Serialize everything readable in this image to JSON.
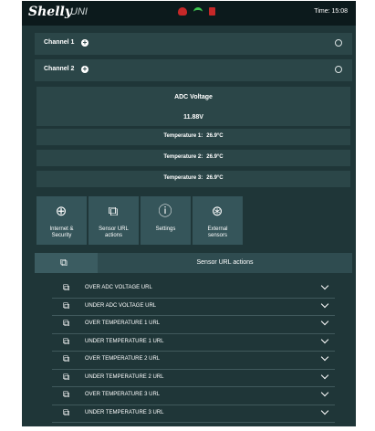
{
  "header": {
    "logo": "Shelly",
    "logo_sub": "UNI",
    "time": "Time: 15:08",
    "status_icons": [
      "cloud-icon",
      "wifi-icon",
      "lock-icon"
    ],
    "colors": {
      "cloud": "#c62828",
      "wifi": "#3ec850",
      "lock": "#c62828"
    }
  },
  "channels": [
    {
      "label": "Channel 1"
    },
    {
      "label": "Channel 2"
    }
  ],
  "adc": {
    "title": "ADC Voltage",
    "value": "11.88V"
  },
  "temperatures": [
    {
      "label": "Temperature 1:",
      "value": "26.9°C"
    },
    {
      "label": "Temperature 2:",
      "value": "26.9°C"
    },
    {
      "label": "Temperature 3:",
      "value": "26.9°C"
    }
  ],
  "tiles": [
    {
      "label": "Internet &\nSecurity",
      "icon": "globe-icon"
    },
    {
      "label": "Sensor URL\nactions",
      "icon": "sensor-url-icon"
    },
    {
      "label": "Settings",
      "icon": "info-icon"
    },
    {
      "label": "External\nsensors",
      "icon": "external-sensor-icon"
    }
  ],
  "sensor_section": {
    "label": "Sensor URL actions",
    "icon": "sensor-url-icon"
  },
  "url_actions": [
    "OVER ADC VOLTAGE URL",
    "UNDER ADC VOLTAGE URL",
    "OVER TEMPERATURE 1 URL",
    "UNDER TEMPERATURE 1 URL",
    "OVER TEMPERATURE 2 URL",
    "UNDER TEMPERATURE 2 URL",
    "OVER TEMPERATURE 3 URL",
    "UNDER TEMPERATURE 3 URL"
  ]
}
